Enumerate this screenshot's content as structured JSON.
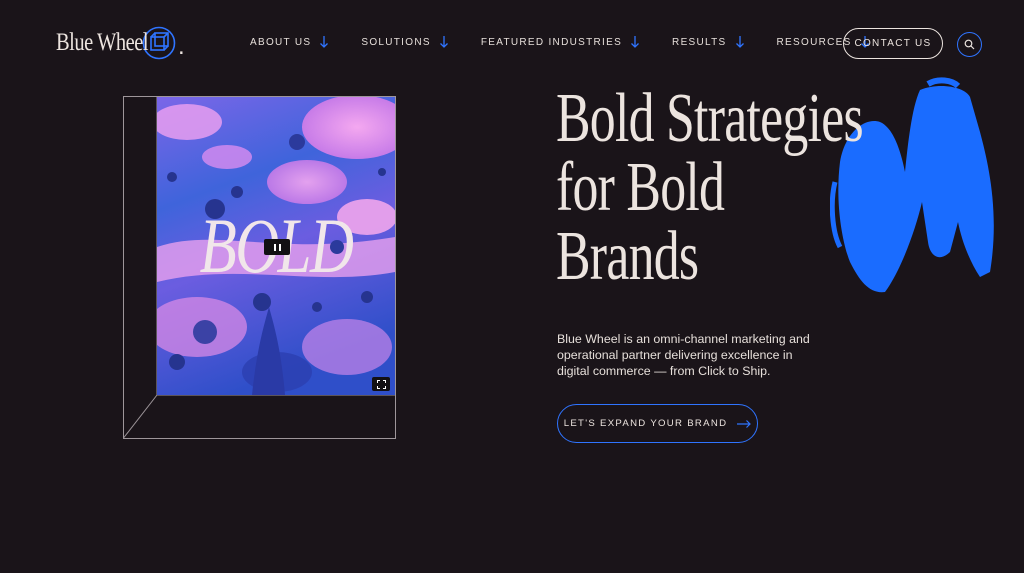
{
  "brand": {
    "name": "Blue Wheel",
    "dot": "."
  },
  "nav": [
    {
      "label": "ABOUT US"
    },
    {
      "label": "SOLUTIONS"
    },
    {
      "label": "FEATURED INDUSTRIES"
    },
    {
      "label": "RESULTS"
    },
    {
      "label": "RESOURCES"
    }
  ],
  "header": {
    "contact_label": "CONTACT US"
  },
  "hero": {
    "media_word": "BOLD",
    "headline_lines": [
      "Bold Strategies",
      "for Bold",
      "Brands"
    ],
    "description": "Blue Wheel is an omni-channel marketing and operational partner delivering excellence in digital commerce — from Click to Ship.",
    "cta_label": "LET'S EXPAND YOUR BRAND"
  },
  "icons": {
    "nav_arrow": "arrow-down-icon",
    "search": "search-icon",
    "pause": "pause-icon",
    "expand": "expand-icon",
    "cta_arrow": "arrow-right-icon",
    "logo_mark": "cube-icon"
  },
  "colors": {
    "background": "#1a1419",
    "accent": "#2f74ff",
    "text": "#ece4df"
  }
}
